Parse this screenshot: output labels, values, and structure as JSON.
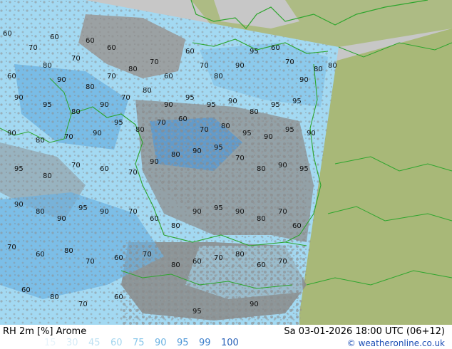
{
  "header": {
    "title_left": "RH 2m [%] Arome",
    "title_right": "Sa 03-01-2026 18:00 UTC (06+12)"
  },
  "legend": {
    "levels": [
      {
        "label": "15",
        "color": "#e8f4fb"
      },
      {
        "label": "30",
        "color": "#d6ecf7"
      },
      {
        "label": "45",
        "color": "#bfe2f3"
      },
      {
        "label": "60",
        "color": "#a4d6ef"
      },
      {
        "label": "75",
        "color": "#86c6ea"
      },
      {
        "label": "90",
        "color": "#6bb2e2"
      },
      {
        "label": "95",
        "color": "#4f98d8"
      },
      {
        "label": "99",
        "color": "#3a7ecb"
      },
      {
        "label": "100",
        "color": "#2a62b8"
      }
    ]
  },
  "credit": {
    "symbol": "©",
    "text": "weatheronline.co.uk"
  },
  "map": {
    "colors": {
      "outside_domain": "#c7c7c7",
      "land_outside": "#a8b878",
      "sea": "#a3d9f2",
      "terrain_gray": "#8e8e8e",
      "border": "#2da52d"
    },
    "labels": [
      {
        "v": "60"
      },
      {
        "v": "70"
      },
      {
        "v": "60"
      },
      {
        "v": "60"
      },
      {
        "v": "80"
      },
      {
        "v": "70"
      },
      {
        "v": "60"
      },
      {
        "v": "60"
      },
      {
        "v": "90"
      },
      {
        "v": "80"
      },
      {
        "v": "70"
      },
      {
        "v": "80"
      },
      {
        "v": "70"
      },
      {
        "v": "60"
      },
      {
        "v": "60"
      },
      {
        "v": "70"
      },
      {
        "v": "80"
      },
      {
        "v": "90"
      },
      {
        "v": "95"
      },
      {
        "v": "60"
      },
      {
        "v": "70"
      },
      {
        "v": "90"
      },
      {
        "v": "80"
      },
      {
        "v": "80"
      },
      {
        "v": "90"
      },
      {
        "v": "95"
      },
      {
        "v": "80"
      },
      {
        "v": "90"
      },
      {
        "v": "70"
      },
      {
        "v": "80"
      },
      {
        "v": "90"
      },
      {
        "v": "95"
      },
      {
        "v": "95"
      },
      {
        "v": "90"
      },
      {
        "v": "80"
      },
      {
        "v": "95"
      },
      {
        "v": "95"
      },
      {
        "v": "90"
      },
      {
        "v": "80"
      },
      {
        "v": "70"
      },
      {
        "v": "90"
      },
      {
        "v": "95"
      },
      {
        "v": "80"
      },
      {
        "v": "70"
      },
      {
        "v": "60"
      },
      {
        "v": "70"
      },
      {
        "v": "80"
      },
      {
        "v": "95"
      },
      {
        "v": "90"
      },
      {
        "v": "95"
      },
      {
        "v": "90"
      },
      {
        "v": "95"
      },
      {
        "v": "80"
      },
      {
        "v": "70"
      },
      {
        "v": "60"
      },
      {
        "v": "70"
      },
      {
        "v": "90"
      },
      {
        "v": "80"
      },
      {
        "v": "90"
      },
      {
        "v": "95"
      },
      {
        "v": "70"
      },
      {
        "v": "80"
      },
      {
        "v": "90"
      },
      {
        "v": "95"
      },
      {
        "v": "90"
      },
      {
        "v": "80"
      },
      {
        "v": "90"
      },
      {
        "v": "95"
      },
      {
        "v": "90"
      },
      {
        "v": "70"
      },
      {
        "v": "60"
      },
      {
        "v": "80"
      },
      {
        "v": "90"
      },
      {
        "v": "95"
      },
      {
        "v": "90"
      },
      {
        "v": "80"
      },
      {
        "v": "70"
      },
      {
        "v": "60"
      },
      {
        "v": "70"
      },
      {
        "v": "60"
      },
      {
        "v": "80"
      },
      {
        "v": "70"
      },
      {
        "v": "60"
      },
      {
        "v": "70"
      },
      {
        "v": "80"
      },
      {
        "v": "60"
      },
      {
        "v": "70"
      },
      {
        "v": "80"
      },
      {
        "v": "60"
      },
      {
        "v": "70"
      },
      {
        "v": "60"
      },
      {
        "v": "80"
      },
      {
        "v": "70"
      },
      {
        "v": "60"
      },
      {
        "v": "95"
      },
      {
        "v": "90"
      }
    ]
  }
}
